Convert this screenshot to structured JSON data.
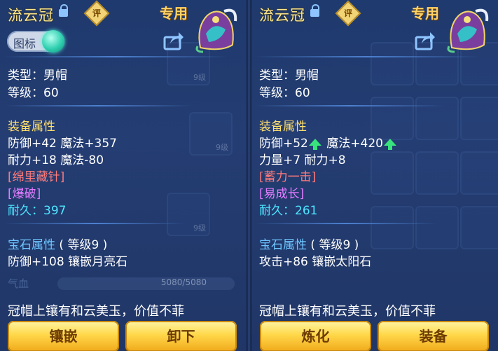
{
  "left": {
    "item_name": "流云冠",
    "eval_label": "评",
    "exclusive_label": "专用",
    "toggle_label": "图标",
    "type_line": "类型：男帽",
    "level_line": "等级：60",
    "attr_header": "装备属性",
    "attr_line1": "防御+42 魔法+357",
    "attr_line2": "耐力+18 魔法-80",
    "special1": "[绵里藏针]",
    "special2": "[爆破]",
    "durability_label": "耐久：",
    "durability_value": "397",
    "gem_header": "宝石属性",
    "gem_level": "( 等级9 )",
    "gem_line": "防御+108 镶嵌月亮石",
    "hp_label": "气血",
    "hp_value": "5080/5080",
    "bg_level1": "9级",
    "bg_level2": "9级",
    "bg_level3": "9级",
    "description": "冠帽上镶有和云美玉，价值不菲",
    "button1": "镶嵌",
    "button2": "卸下"
  },
  "right": {
    "item_name": "流云冠",
    "eval_label": "评",
    "exclusive_label": "专用",
    "type_line": "类型：男帽",
    "level_line": "等级：60",
    "attr_header": "装备属性",
    "attr_line1_a": "防御+52",
    "attr_line1_b": " 魔法+420",
    "attr_line2": "力量+7 耐力+8",
    "special1": "[蓄力一击]",
    "special2": "[易成长]",
    "durability_label": "耐久：",
    "durability_value": "261",
    "gem_header": "宝石属性",
    "gem_level": "( 等级9 )",
    "gem_line": "攻击+86 镶嵌太阳石",
    "description": "冠帽上镶有和云美玉，价值不菲",
    "button1": "炼化",
    "button2": "装备"
  },
  "icons": [
    "lock-icon",
    "evaluate-icon",
    "hat-icon",
    "share-icon",
    "stat-up-arrow-icon"
  ],
  "colors": {
    "panel_bg": "#243d72",
    "title": "#ffe88a",
    "section_header": "#ffdf6e",
    "special_red": "#ff7b7b",
    "special_purple": "#e47cff",
    "durability": "#4fe4ff",
    "gem_header": "#6fc6ff",
    "stat_up": "#38e37d",
    "button": "#ffd84a"
  }
}
